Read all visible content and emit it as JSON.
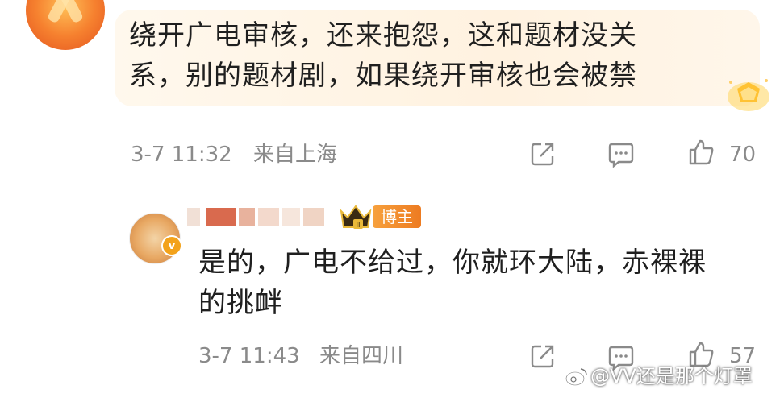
{
  "comment1": {
    "text_line1": "绕开广电审核，还来抱怨，这和题材没关",
    "text_line2": "系，别的题材剧，如果绕开审核也会被禁",
    "timestamp": "3-7 11:32",
    "location": "来自上海",
    "likes": "70"
  },
  "comment2": {
    "badge": "博主",
    "badge_level": "II",
    "avatar_badge": "v",
    "text_line1": "是的，广电不给过，你就环大陆，赤裸裸",
    "text_line2": "的挑衅",
    "timestamp": "3-7 11:43",
    "location": "来自四川",
    "likes": "57"
  },
  "watermark": "@VV还是那个灯罩",
  "icons": [
    "share-icon",
    "comment-icon",
    "like-icon",
    "crown-icon",
    "gem-icon",
    "weibo-icon"
  ],
  "colors": {
    "accent": "#f08a2a",
    "meta": "#8a8a8a",
    "bubble": "#fff4e6"
  }
}
